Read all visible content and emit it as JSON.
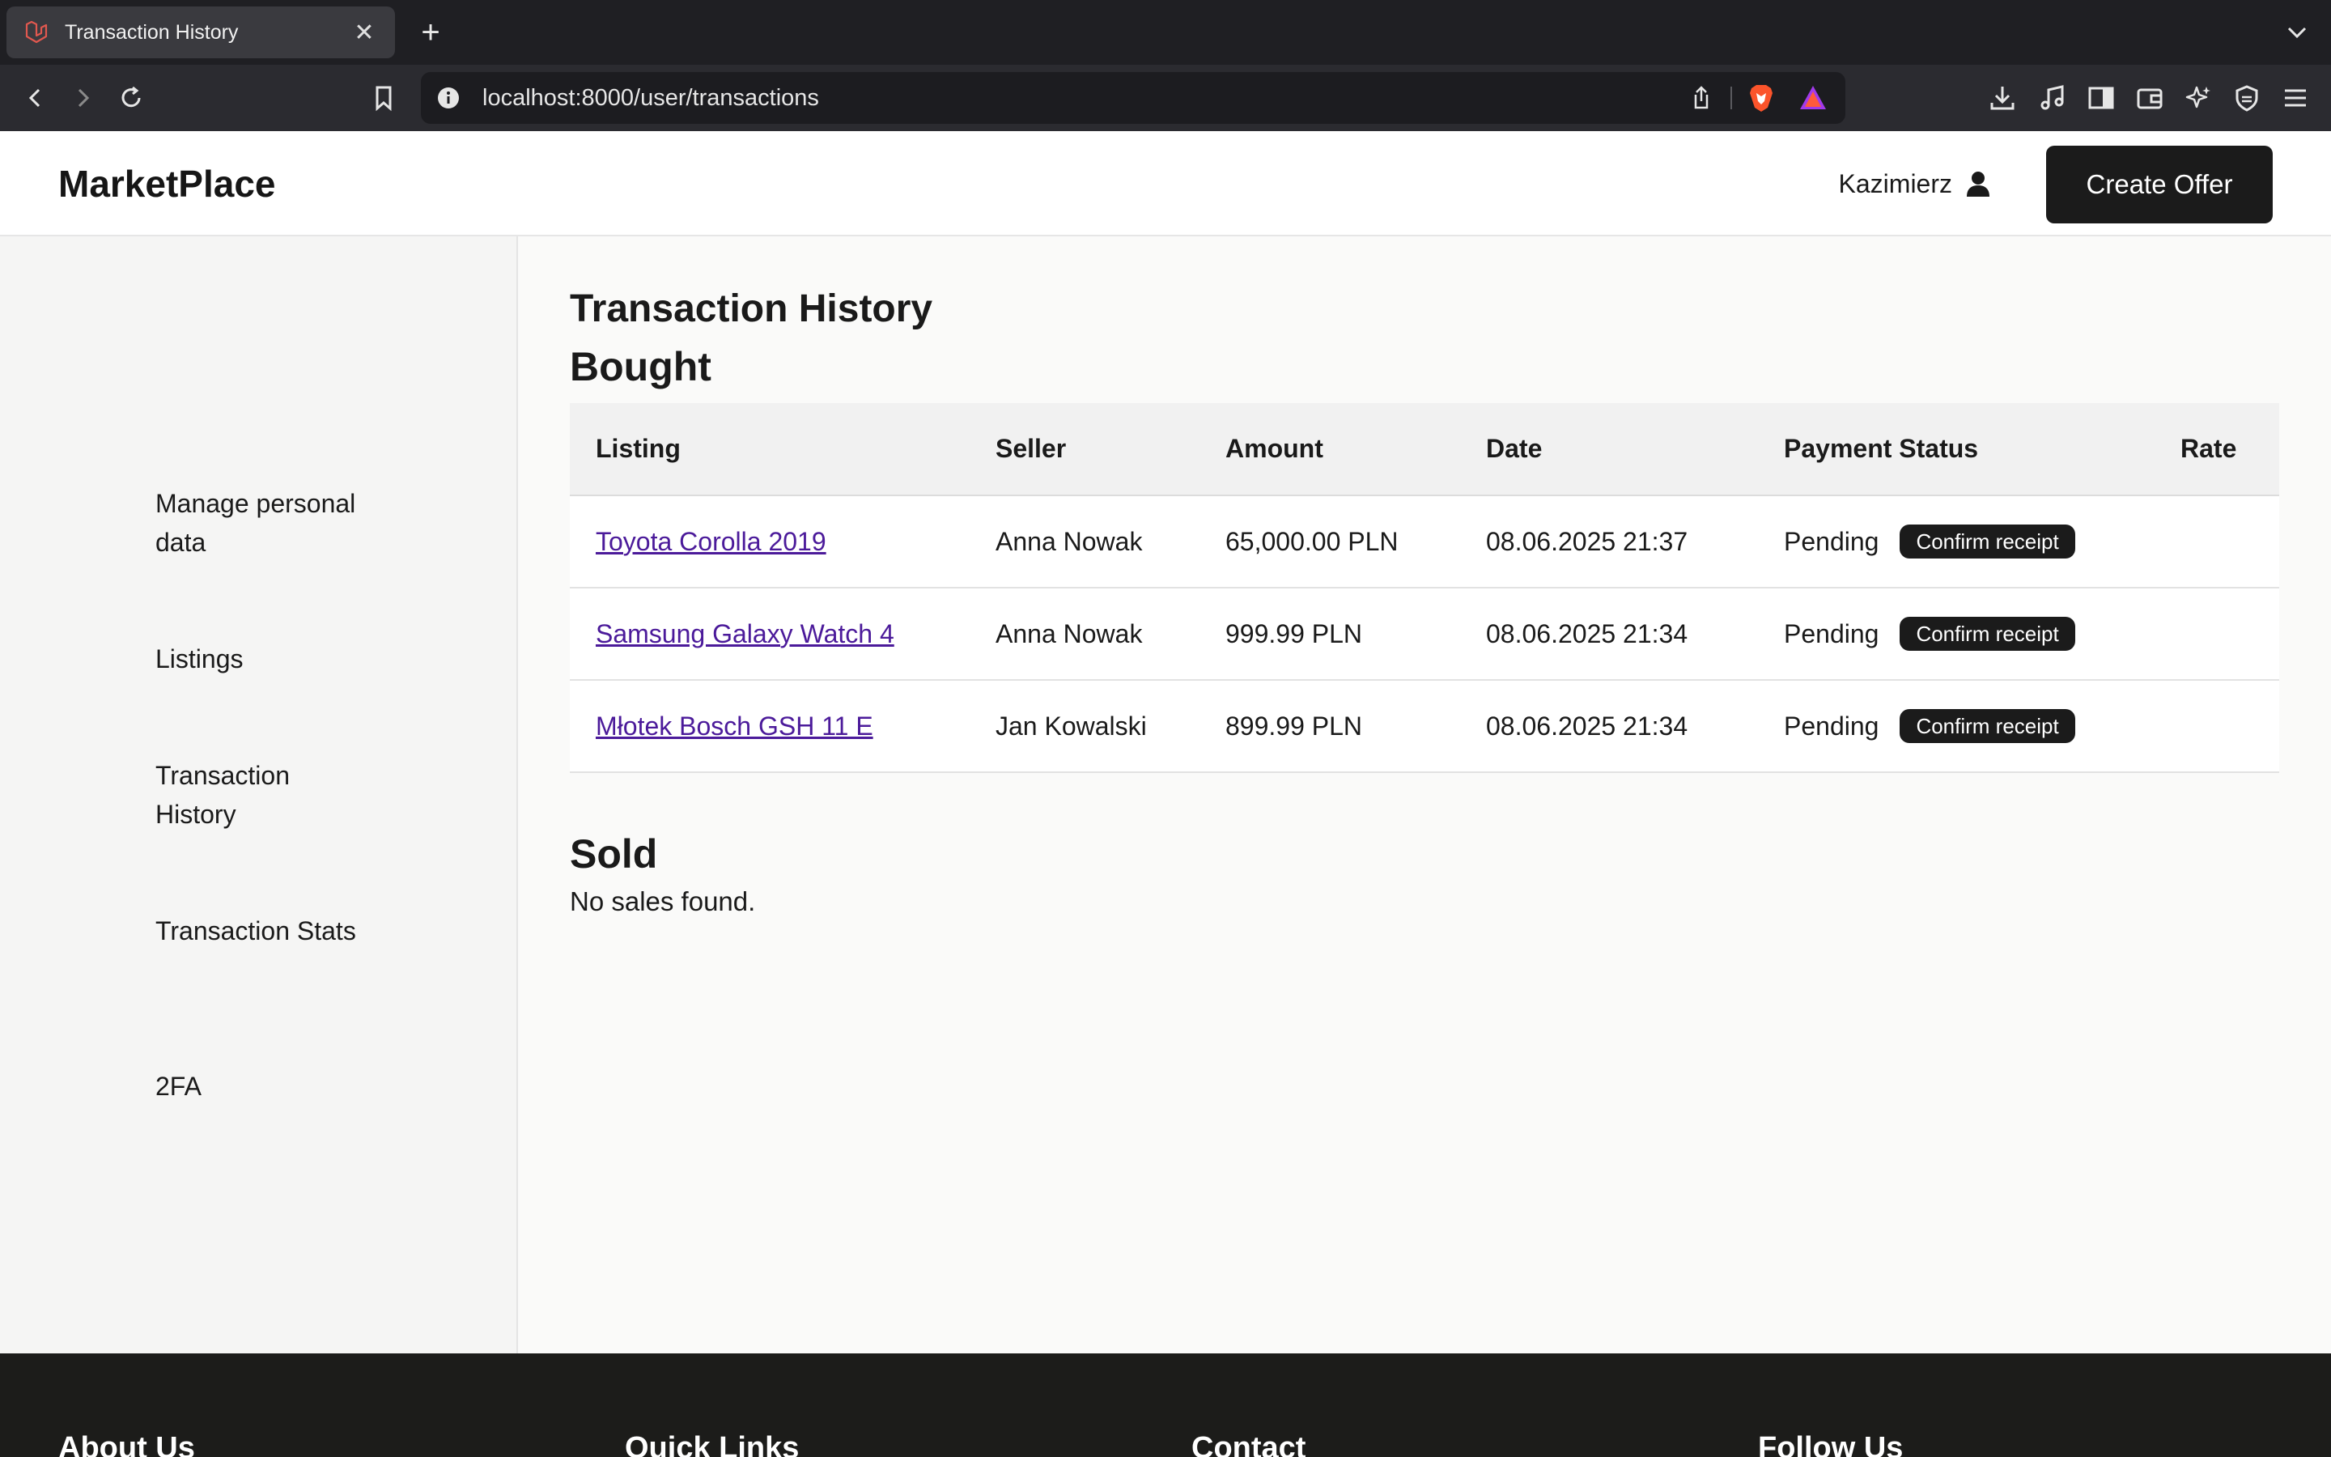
{
  "browser": {
    "tab_title": "Transaction History",
    "url": "localhost:8000/user/transactions"
  },
  "header": {
    "brand": "MarketPlace",
    "username": "Kazimierz",
    "create_offer_label": "Create Offer"
  },
  "sidebar": {
    "items": [
      {
        "label": "Manage personal data"
      },
      {
        "label": "Listings"
      },
      {
        "label": "Transaction History"
      },
      {
        "label": "Transaction Stats"
      },
      {
        "label": "2FA"
      }
    ]
  },
  "main": {
    "page_title": "Transaction History",
    "bought_title": "Bought",
    "columns": [
      "Listing",
      "Seller",
      "Amount",
      "Date",
      "Payment Status",
      "Rate"
    ],
    "rows": [
      {
        "listing": "Toyota Corolla 2019",
        "seller": "Anna Nowak",
        "amount": "65,000.00 PLN",
        "date": "08.06.2025 21:37",
        "status": "Pending",
        "action": "Confirm receipt"
      },
      {
        "listing": "Samsung Galaxy Watch 4",
        "seller": "Anna Nowak",
        "amount": "999.99 PLN",
        "date": "08.06.2025 21:34",
        "status": "Pending",
        "action": "Confirm receipt"
      },
      {
        "listing": "Młotek Bosch GSH 11 E",
        "seller": "Jan Kowalski",
        "amount": "899.99 PLN",
        "date": "08.06.2025 21:34",
        "status": "Pending",
        "action": "Confirm receipt"
      }
    ],
    "sold_title": "Sold",
    "no_sales_text": "No sales found."
  },
  "footer": {
    "columns": [
      "About Us",
      "Quick Links",
      "Contact",
      "Follow Us"
    ]
  },
  "colors": {
    "accent_dark": "#1b1b1b",
    "link": "#4b1a9a",
    "favicon": "#e0584f"
  }
}
